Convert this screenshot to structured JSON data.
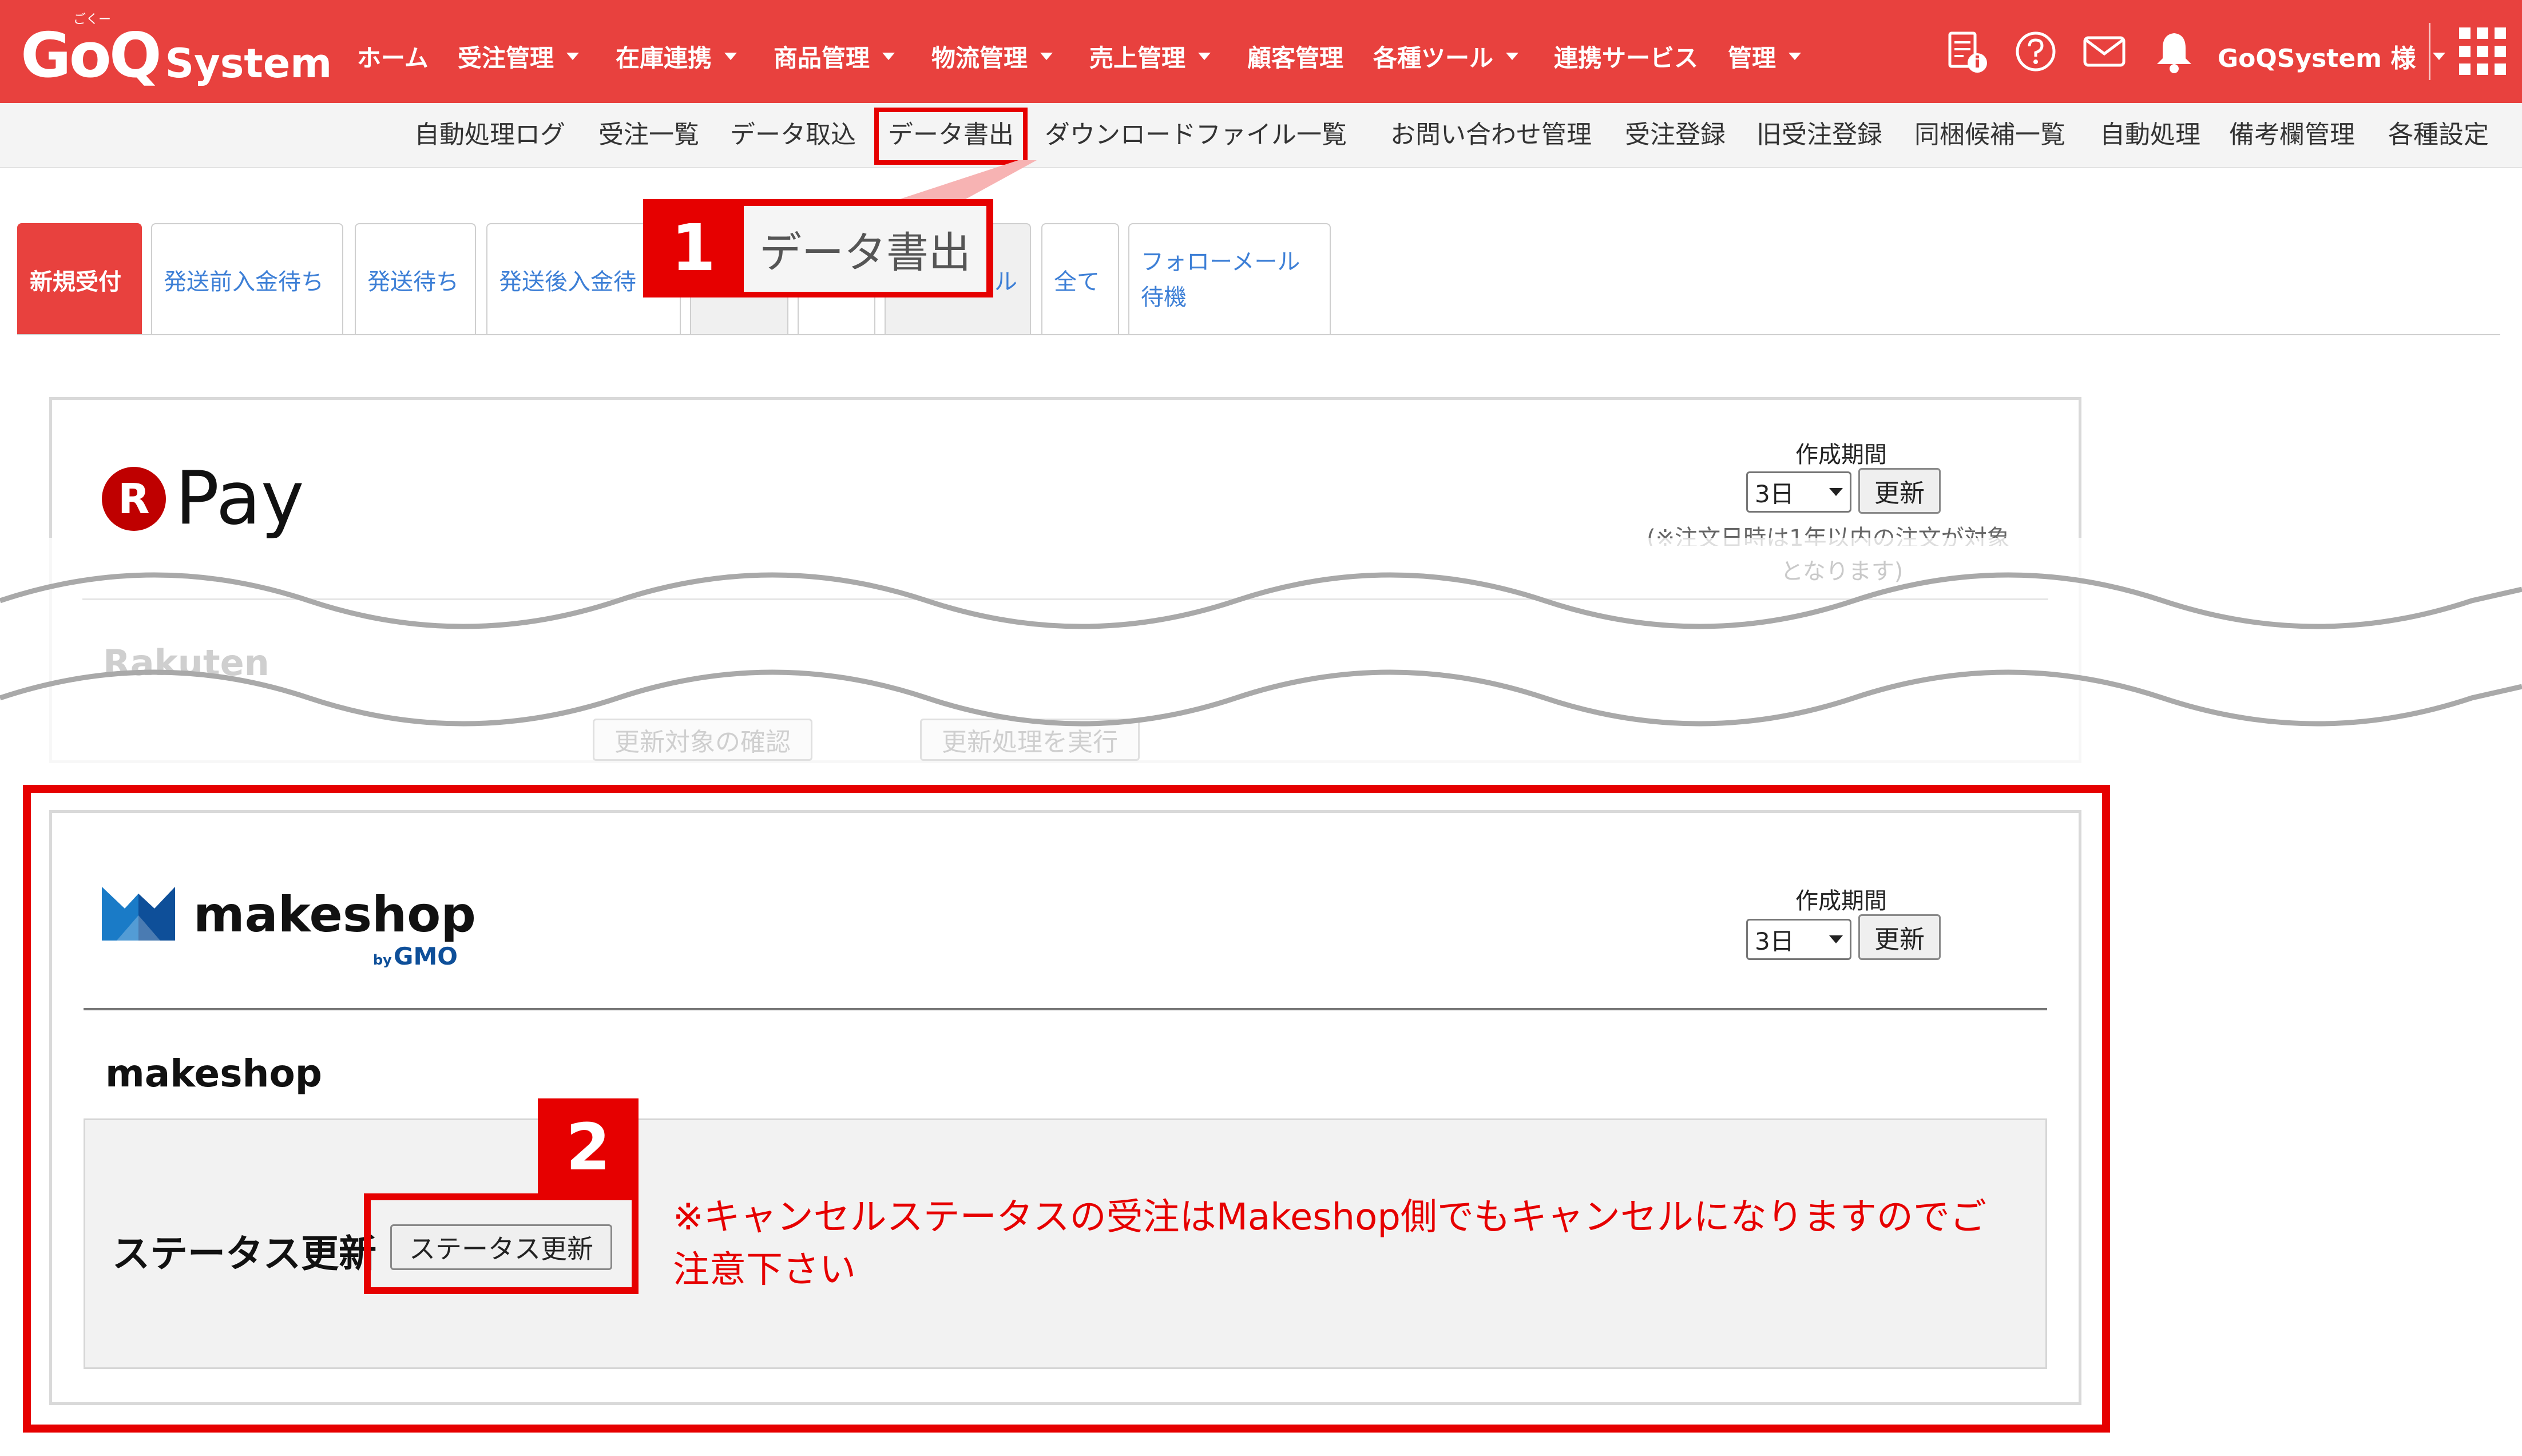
{
  "header": {
    "logo_main": "GoQ",
    "logo_sub": "System",
    "logo_ruby": "ごくー",
    "nav": [
      {
        "label": "ホーム",
        "dropdown": false
      },
      {
        "label": "受注管理",
        "dropdown": true
      },
      {
        "label": "在庫連携",
        "dropdown": true
      },
      {
        "label": "商品管理",
        "dropdown": true
      },
      {
        "label": "物流管理",
        "dropdown": true
      },
      {
        "label": "売上管理",
        "dropdown": true
      },
      {
        "label": "顧客管理",
        "dropdown": false
      },
      {
        "label": "各種ツール",
        "dropdown": true
      },
      {
        "label": "連携サービス",
        "dropdown": false
      },
      {
        "label": "管理",
        "dropdown": true
      }
    ],
    "icons": [
      "document-info-icon",
      "help-icon",
      "mail-icon",
      "bell-icon",
      "apps-grid-icon"
    ],
    "user_label": "GoQSystem 様",
    "bar_color": "#e8413e"
  },
  "subnav": {
    "items": [
      "自動処理ログ",
      "受注一覧",
      "データ取込",
      "データ書出",
      "ダウンロードファイル一覧",
      "お問い合わせ管理",
      "受注登録",
      "旧受注登録",
      "同梱候補一覧",
      "自動処理",
      "備考欄管理",
      "各種設定"
    ],
    "highlighted": "データ書出"
  },
  "tabs": {
    "items": [
      "新規受付",
      "発送前入金待ち",
      "発送待ち",
      "発送後入金待",
      "",
      "",
      "ル",
      "全て",
      "フォローメール\n待機"
    ],
    "active": "新規受付"
  },
  "callout1": {
    "number": "1",
    "text": "データ書出"
  },
  "rpay": {
    "logo_letter": "R",
    "logo_text": "Pay",
    "period_label": "作成期間",
    "period_value": "3日",
    "update_label": "更新",
    "note_line1": "(※注文日時は1年以内の注文が対象",
    "note_line2": "となります)",
    "section_label": "Rakuten",
    "check_button": "更新対象の確認",
    "run_button": "更新処理を実行"
  },
  "makeshop": {
    "logo_text": "makeshop",
    "logo_by": "by",
    "logo_gmo": "GMO",
    "period_label": "作成期間",
    "period_value": "3日",
    "update_label": "更新",
    "title": "makeshop",
    "status_label": "ステータス更新",
    "status_button": "ステータス更新",
    "warning": "※キャンセルステータスの受注はMakeshop側でもキャンセルになりますのでご注意下さい",
    "badge_number": "2",
    "accent": "#e60000"
  }
}
